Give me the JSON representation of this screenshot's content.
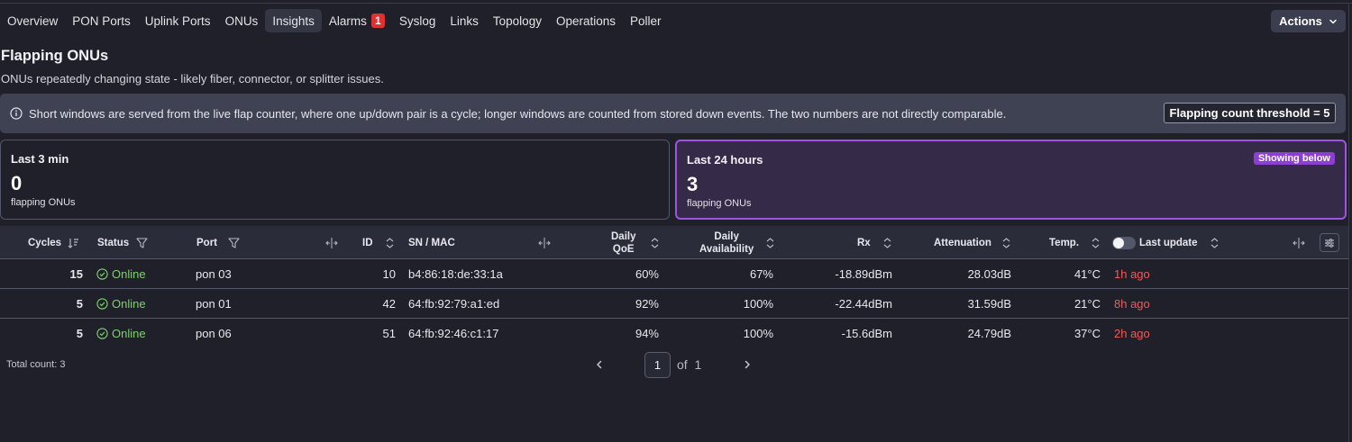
{
  "tabs": [
    {
      "label": "Overview"
    },
    {
      "label": "PON Ports"
    },
    {
      "label": "Uplink Ports"
    },
    {
      "label": "ONUs"
    },
    {
      "label": "Insights"
    },
    {
      "label": "Alarms",
      "badge": "1"
    },
    {
      "label": "Syslog"
    },
    {
      "label": "Links"
    },
    {
      "label": "Topology"
    },
    {
      "label": "Operations"
    },
    {
      "label": "Poller"
    }
  ],
  "active_tab": "Insights",
  "actions_label": "Actions",
  "page": {
    "title": "Flapping ONUs",
    "subtitle": "ONUs repeatedly changing state - likely fiber, connector, or splitter issues."
  },
  "info": {
    "text": "Short windows are served from the live flap counter, where one up/down pair is a cycle; longer windows are counted from stored down events. The two numbers are not directly comparable.",
    "threshold_label": "Flapping count threshold = 5"
  },
  "cards": [
    {
      "label": "Last 3 min",
      "value": "0",
      "unit": "flapping ONUs"
    },
    {
      "label": "Last 24 hours",
      "value": "3",
      "unit": "flapping ONUs",
      "badge": "Showing below"
    }
  ],
  "table": {
    "headers": {
      "cycles": "Cycles",
      "status": "Status",
      "port": "Port",
      "id": "ID",
      "sn_mac": "SN / MAC",
      "daily_qoe_1": "Daily",
      "daily_qoe_2": "QoE",
      "daily_avail_1": "Daily",
      "daily_avail_2": "Availability",
      "rx": "Rx",
      "attenuation": "Attenuation",
      "temp": "Temp.",
      "last_update": "Last update"
    },
    "rows": [
      {
        "cycles": "15",
        "status": "Online",
        "port": "pon 03",
        "id": "10",
        "sn_mac": "b4:86:18:de:33:1a",
        "qoe": "60%",
        "availability": "67%",
        "rx": "-18.89dBm",
        "attenuation": "28.03dB",
        "temp": "41°C",
        "last_update": "1h ago"
      },
      {
        "cycles": "5",
        "status": "Online",
        "port": "pon 01",
        "id": "42",
        "sn_mac": "64:fb:92:79:a1:ed",
        "qoe": "92%",
        "availability": "100%",
        "rx": "-22.44dBm",
        "attenuation": "31.59dB",
        "temp": "21°C",
        "last_update": "8h ago"
      },
      {
        "cycles": "5",
        "status": "Online",
        "port": "pon 06",
        "id": "51",
        "sn_mac": "64:fb:92:46:c1:17",
        "qoe": "94%",
        "availability": "100%",
        "rx": "-15.6dBm",
        "attenuation": "24.79dB",
        "temp": "37°C",
        "last_update": "2h ago"
      }
    ]
  },
  "footer": {
    "total": "Total count: 3",
    "page": "1",
    "of": "of",
    "total_pages": "1"
  },
  "colors": {
    "background": "#1f2029",
    "accent": "#a152e6",
    "online": "#7dd36d",
    "alert": "#e03131",
    "stale": "#f05a5a"
  }
}
